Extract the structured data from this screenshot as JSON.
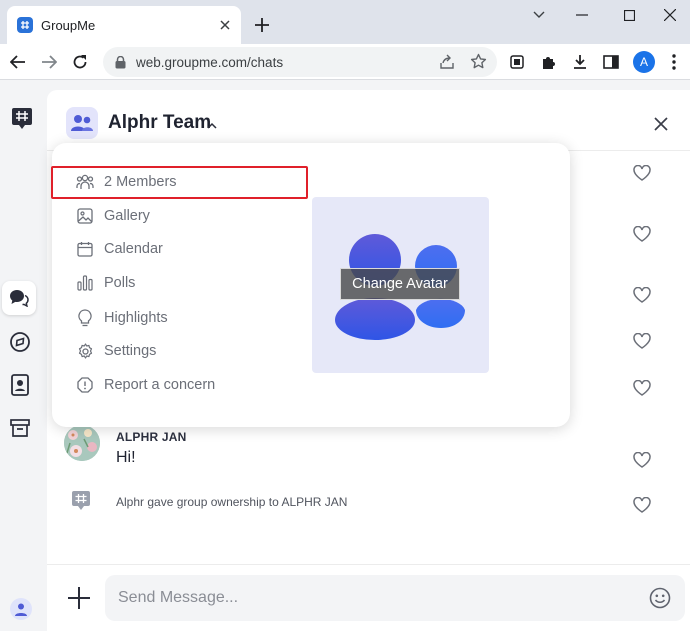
{
  "browser": {
    "tab_title": "GroupMe",
    "url": "web.groupme.com/chats",
    "profile_initial": "A"
  },
  "chat": {
    "group_name": "Alphr Team",
    "messages": [
      {
        "sender": "ALPHR JAN",
        "text": "Hi!"
      }
    ],
    "system_message": "Alphr gave group ownership to ALPHR JAN",
    "composer_placeholder": "Send Message..."
  },
  "group_menu": {
    "items": [
      {
        "label": "2 Members",
        "icon": "members-icon"
      },
      {
        "label": "Gallery",
        "icon": "gallery-icon"
      },
      {
        "label": "Calendar",
        "icon": "calendar-icon"
      },
      {
        "label": "Polls",
        "icon": "polls-icon"
      },
      {
        "label": "Highlights",
        "icon": "lightbulb-icon"
      },
      {
        "label": "Settings",
        "icon": "gear-icon"
      },
      {
        "label": "Report a concern",
        "icon": "warning-icon"
      }
    ],
    "change_avatar_label": "Change Avatar"
  },
  "colors": {
    "accent": "#4f5bd5",
    "highlight_border": "#e0202a",
    "browser_frame": "#dfe3eb"
  }
}
